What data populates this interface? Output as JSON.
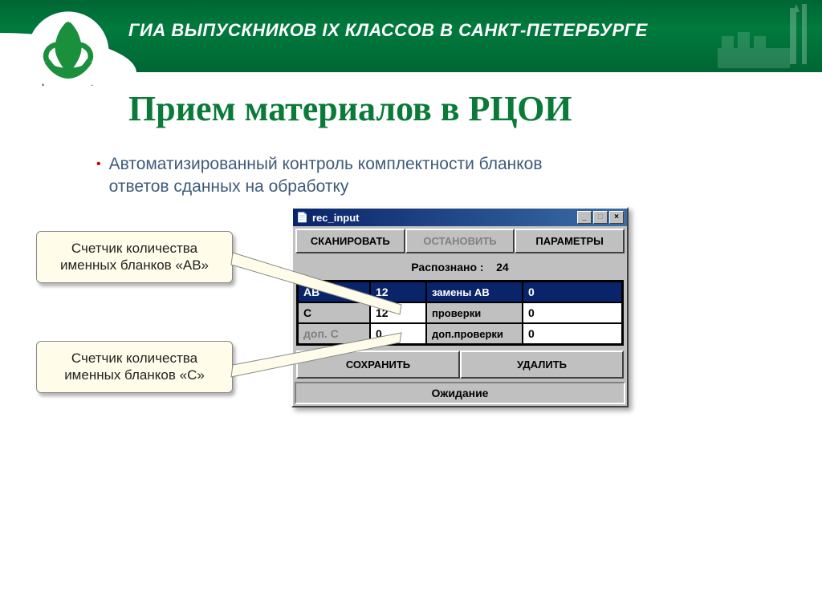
{
  "header": {
    "title": "ГИА ВЫПУСКНИКОВ IX КЛАССОВ В САНКТ-ПЕТЕРБУРГЕ",
    "logo_label": "РЦОКОиИТ"
  },
  "slide": {
    "title": "Прием материалов в РЦОИ",
    "bullet": "Автоматизированный контроль комплектности бланков ответов сданных на обработку"
  },
  "callouts": {
    "ab": "Счетчик количества именных бланков «АВ»",
    "c": "Счетчик количества именных бланков «С»"
  },
  "window": {
    "title": "rec_input",
    "buttons": {
      "scan": "СКАНИРОВАТЬ",
      "stop": "ОСТАНОВИТЬ",
      "params": "ПАРАМЕТРЫ",
      "save": "СОХРАНИТЬ",
      "delete": "УДАЛИТЬ"
    },
    "recognized_label": "Распознано :",
    "recognized_value": "24",
    "rows": {
      "ab": {
        "label": "АВ",
        "value": "12",
        "label2": "замены АВ",
        "value2": "0"
      },
      "c": {
        "label": "С",
        "value": "12",
        "label2": "проверки",
        "value2": "0"
      },
      "dopc": {
        "label": "доп.  С",
        "value": "0",
        "label2": "доп.проверки",
        "value2": "0"
      }
    },
    "status": "Ожидание",
    "sysbuttons": {
      "min": "_",
      "max": "□",
      "close": "×"
    }
  }
}
